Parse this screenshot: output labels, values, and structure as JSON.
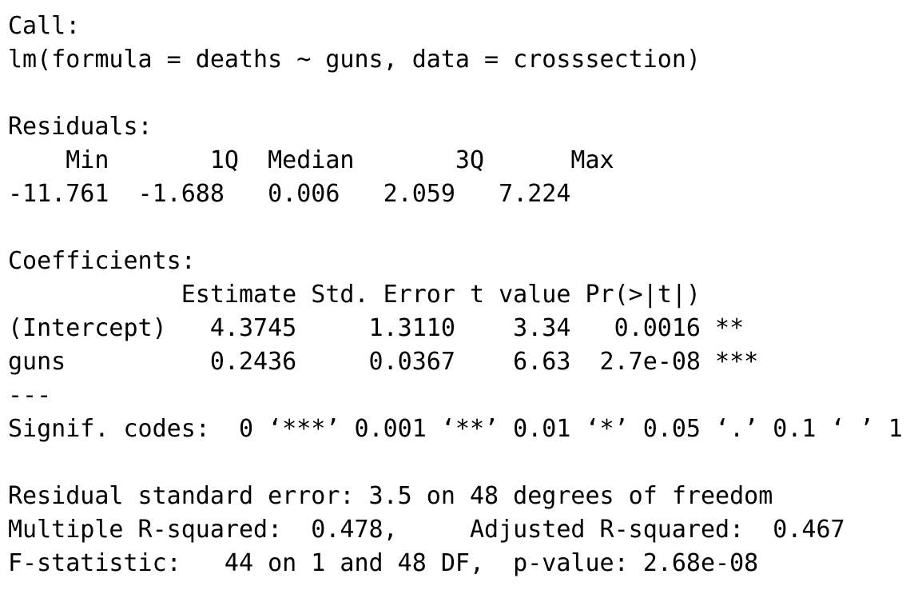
{
  "output": {
    "call_header": "Call:",
    "call": "lm(formula = deaths ~ guns, data = crosssection)",
    "residuals_header": "Residuals:",
    "residuals_columns": "    Min       1Q  Median       3Q      Max ",
    "residuals_values": "-11.761  -1.688   0.006   2.059   7.224 ",
    "coefficients_header": "Coefficients:",
    "coef_columns": "            Estimate Std. Error t value Pr(>|t|)    ",
    "coef_intercept": "(Intercept)   4.3745     1.3110    3.34   0.0016 ** ",
    "coef_guns": "guns          0.2436     0.0367    6.63  2.7e-08 ***",
    "separator": "---",
    "signif_codes": "Signif. codes:  0 ‘***’ 0.001 ‘**’ 0.01 ‘*’ 0.05 ‘.’ 0.1 ‘ ’ 1",
    "residual_se": "Residual standard error: 3.5 on 48 degrees of freedom",
    "r_squared": "Multiple R-squared:  0.478,     Adjusted R-squared:  0.467 ",
    "f_statistic": "F-statistic:   44 on 1 and 48 DF,  p-value: 2.68e-08"
  }
}
